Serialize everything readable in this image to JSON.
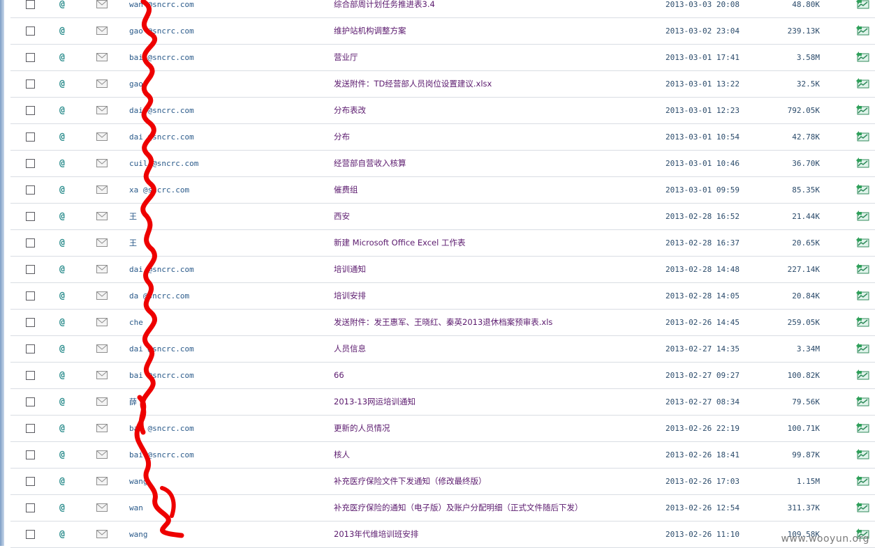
{
  "mail_list": {
    "rows": [
      {
        "from": "wan     @sncrc.com",
        "subject": "综合部周计划任务推进表3.4",
        "date": "2013-03-03 20:08",
        "size": "48.80K"
      },
      {
        "from": "gao     @sncrc.com",
        "subject": "维护站机构调整方案",
        "date": "2013-03-02 23:04",
        "size": "239.13K"
      },
      {
        "from": "bai     @sncrc.com",
        "subject": "营业厅",
        "date": "2013-03-01 17:41",
        "size": "3.58M"
      },
      {
        "from": "gaoj",
        "subject": "发送附件：TD经营部人员岗位设置建议.xlsx",
        "date": "2013-03-01 13:22",
        "size": "32.5K"
      },
      {
        "from": "dai     @sncrc.com",
        "subject": "分布表改",
        "date": "2013-03-01 12:23",
        "size": "792.05K"
      },
      {
        "from": "dai     @sncrc.com",
        "subject": "分布",
        "date": "2013-03-01 10:54",
        "size": "42.78K"
      },
      {
        "from": "cuil     @sncrc.com",
        "subject": "经营部自营收入核算",
        "date": "2013-03-01 10:46",
        "size": "36.70K"
      },
      {
        "from": "xa     @sncrc.com",
        "subject": "催费组",
        "date": "2013-03-01 09:59",
        "size": "85.35K"
      },
      {
        "from": "王",
        "subject": "西安",
        "date": "2013-02-28 16:52",
        "size": "21.44K"
      },
      {
        "from": "王",
        "subject": "新建 Microsoft Office Excel 工作表",
        "date": "2013-02-28 16:37",
        "size": "20.65K"
      },
      {
        "from": "dai     @sncrc.com",
        "subject": "培训通知",
        "date": "2013-02-28 14:48",
        "size": "227.14K"
      },
      {
        "from": "da     @sncrc.com",
        "subject": "培训安排",
        "date": "2013-02-28 14:05",
        "size": "20.84K"
      },
      {
        "from": "che     ",
        "subject": "发送附件：发王惠军、王晓红、秦英2013退休档案预审表.xls",
        "date": "2013-02-26 14:45",
        "size": "259.05K"
      },
      {
        "from": "dai     @sncrc.com",
        "subject": "人员信息",
        "date": "2013-02-27 14:35",
        "size": "3.34M"
      },
      {
        "from": "bai     @sncrc.com",
        "subject": "66",
        "date": "2013-02-27 09:27",
        "size": "100.82K"
      },
      {
        "from": "薛",
        "subject": "2013-13网运培训通知",
        "date": "2013-02-27 08:34",
        "size": "79.56K"
      },
      {
        "from": "bai     @sncrc.com",
        "subject": "更新的人员情况",
        "date": "2013-02-26 22:19",
        "size": "100.71K"
      },
      {
        "from": "bai     @sncrc.com",
        "subject": "核人",
        "date": "2013-02-26 18:41",
        "size": "99.87K"
      },
      {
        "from": "wang",
        "subject": "补充医疗保险文件下发通知（修改最终版）",
        "date": "2013-02-26 17:03",
        "size": "1.15M"
      },
      {
        "from": "wan",
        "subject": "补充医疗保险的通知（电子版）及账户分配明细（正式文件随后下发）",
        "date": "2013-02-26 12:54",
        "size": "311.37K"
      },
      {
        "from": "wang",
        "subject": "2013年代维培训班安排",
        "date": "2013-02-26 11:10",
        "size": "109.58K"
      }
    ]
  },
  "icons": {
    "attachment": "paperclip-icon",
    "mail": "envelope-icon",
    "flag": "chart-flag-icon"
  },
  "colors": {
    "subject": "#5b1a6e",
    "redaction": "#ee0000",
    "row_border": "#d9dde3"
  },
  "watermark": "www.wooyun.org"
}
